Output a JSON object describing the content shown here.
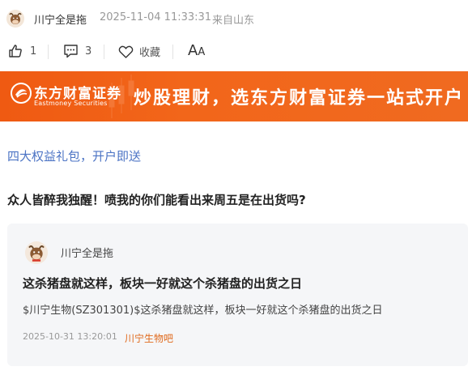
{
  "post": {
    "username": "川宁全是拖",
    "timestamp": "2025-11-04 11:33:31",
    "location": "来自山东",
    "like_count": "1",
    "comment_count": "3",
    "favorite_label": "收藏",
    "font_size_label": "AA"
  },
  "banner": {
    "logo_zh": "东方财富证券",
    "logo_en": "Eastmoney Securities",
    "slogan": "炒股理财，选东方财富证券一站式开户"
  },
  "promo_link": "四大权益礼包，开户即送",
  "post_title": "众人皆醉我独醒！喷我的你们能看出来周五是在出货吗?",
  "quote": {
    "username": "川宁全是拖",
    "title": "这杀猪盘就这样，板块一好就这个杀猪盘的出货之日",
    "body": "$川宁生物(SZ301301)$这杀猪盘就这样，板块一好就这个杀猪盘的出货之日",
    "timestamp": "2025-10-31 13:20:01",
    "bar_name": "川宁生物吧"
  },
  "colors": {
    "banner": "#f06a20",
    "link": "#4b73c4",
    "bar_name": "#e06a1d"
  }
}
